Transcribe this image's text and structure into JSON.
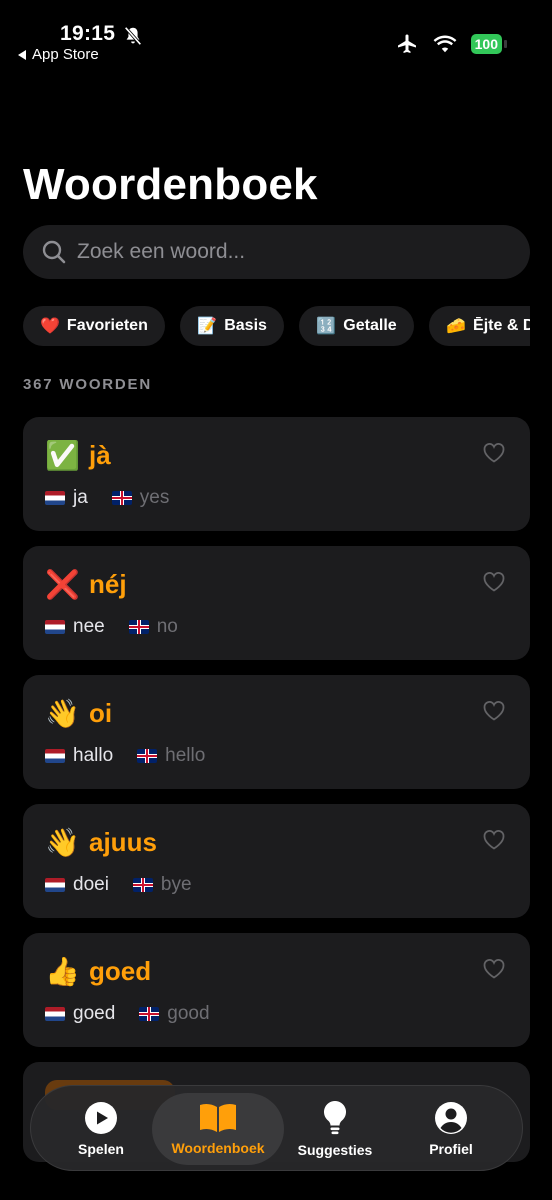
{
  "status_bar": {
    "time": "19:15",
    "back_label": "App Store",
    "battery": "100"
  },
  "page": {
    "title": "Woordenboek"
  },
  "search": {
    "placeholder": "Zoek een woord..."
  },
  "chips": [
    {
      "emoji": "❤️",
      "label": "Favorieten"
    },
    {
      "emoji": "📝",
      "label": "Basis"
    },
    {
      "emoji": "🔢",
      "label": "Getalle"
    },
    {
      "emoji": "🧀",
      "label": "Ējte & D"
    }
  ],
  "count_label": "367 WOORDEN",
  "words": [
    {
      "emoji": "✅",
      "word": "jà",
      "nl": "ja",
      "en": "yes"
    },
    {
      "emoji": "❌",
      "word": "néj",
      "nl": "nee",
      "en": "no"
    },
    {
      "emoji": "👋",
      "word": "oi",
      "nl": "hallo",
      "en": "hello"
    },
    {
      "emoji": "👋",
      "word": "ajuus",
      "nl": "doei",
      "en": "bye"
    },
    {
      "emoji": "👍",
      "word": "goed",
      "nl": "goed",
      "en": "good"
    }
  ],
  "tabs": [
    {
      "label": "Spelen",
      "icon": "play-icon"
    },
    {
      "label": "Woordenboek",
      "icon": "book-icon",
      "active": true
    },
    {
      "label": "Suggesties",
      "icon": "lightbulb-icon"
    },
    {
      "label": "Profiel",
      "icon": "person-icon"
    }
  ],
  "colors": {
    "accent": "#ff9f0a",
    "card_bg": "#1c1c1e",
    "background": "#000000",
    "battery": "#32c759"
  }
}
